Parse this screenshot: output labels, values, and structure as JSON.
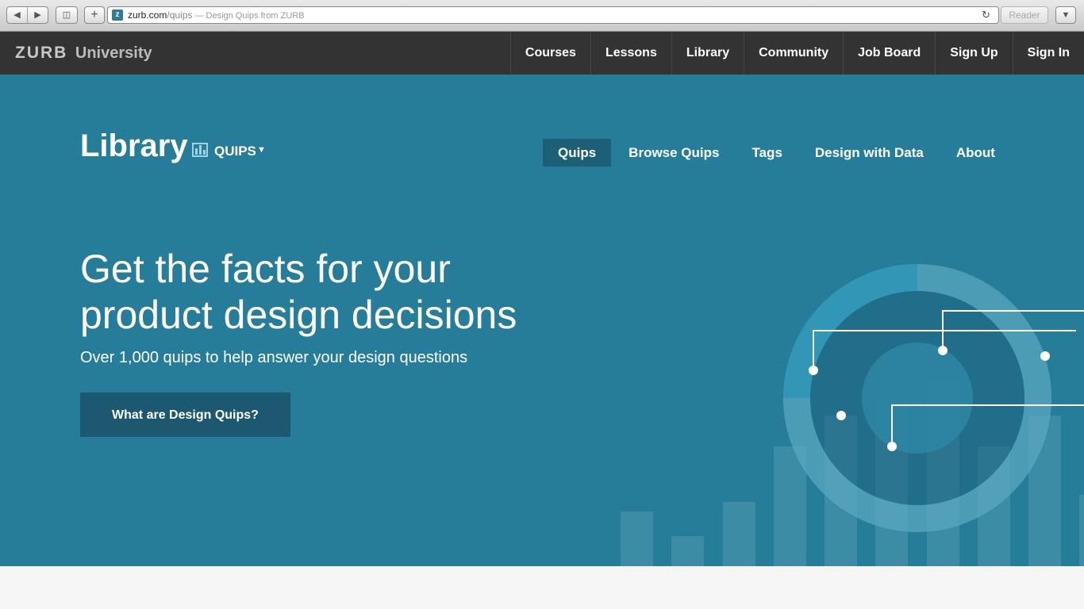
{
  "browser": {
    "url_host": "zurb.com",
    "url_path": "/quips",
    "page_title": " — Design Quips from ZURB",
    "reader_label": "Reader",
    "favicon_letter": "z"
  },
  "site": {
    "logo_brand": "ZURB",
    "logo_product": "University",
    "nav": [
      "Courses",
      "Lessons",
      "Library",
      "Community",
      "Job Board",
      "Sign Up",
      "Sign In"
    ]
  },
  "library": {
    "title": "Library",
    "section_label": "QUIPS",
    "subnav": [
      {
        "label": "Quips",
        "active": true
      },
      {
        "label": "Browse Quips",
        "active": false
      },
      {
        "label": "Tags",
        "active": false
      },
      {
        "label": "Design with Data",
        "active": false
      },
      {
        "label": "About",
        "active": false
      }
    ]
  },
  "hero": {
    "headline_line1": "Get the facts for your",
    "headline_line2": "product design decisions",
    "subline": "Over 1,000 quips to help answer your design questions",
    "cta_label": "What are Design Quips?"
  },
  "colors": {
    "hero_bg": "#267d99",
    "topbar_bg": "#333333",
    "active_tab": "#1c5f76",
    "cta_bg": "#1c5870"
  }
}
